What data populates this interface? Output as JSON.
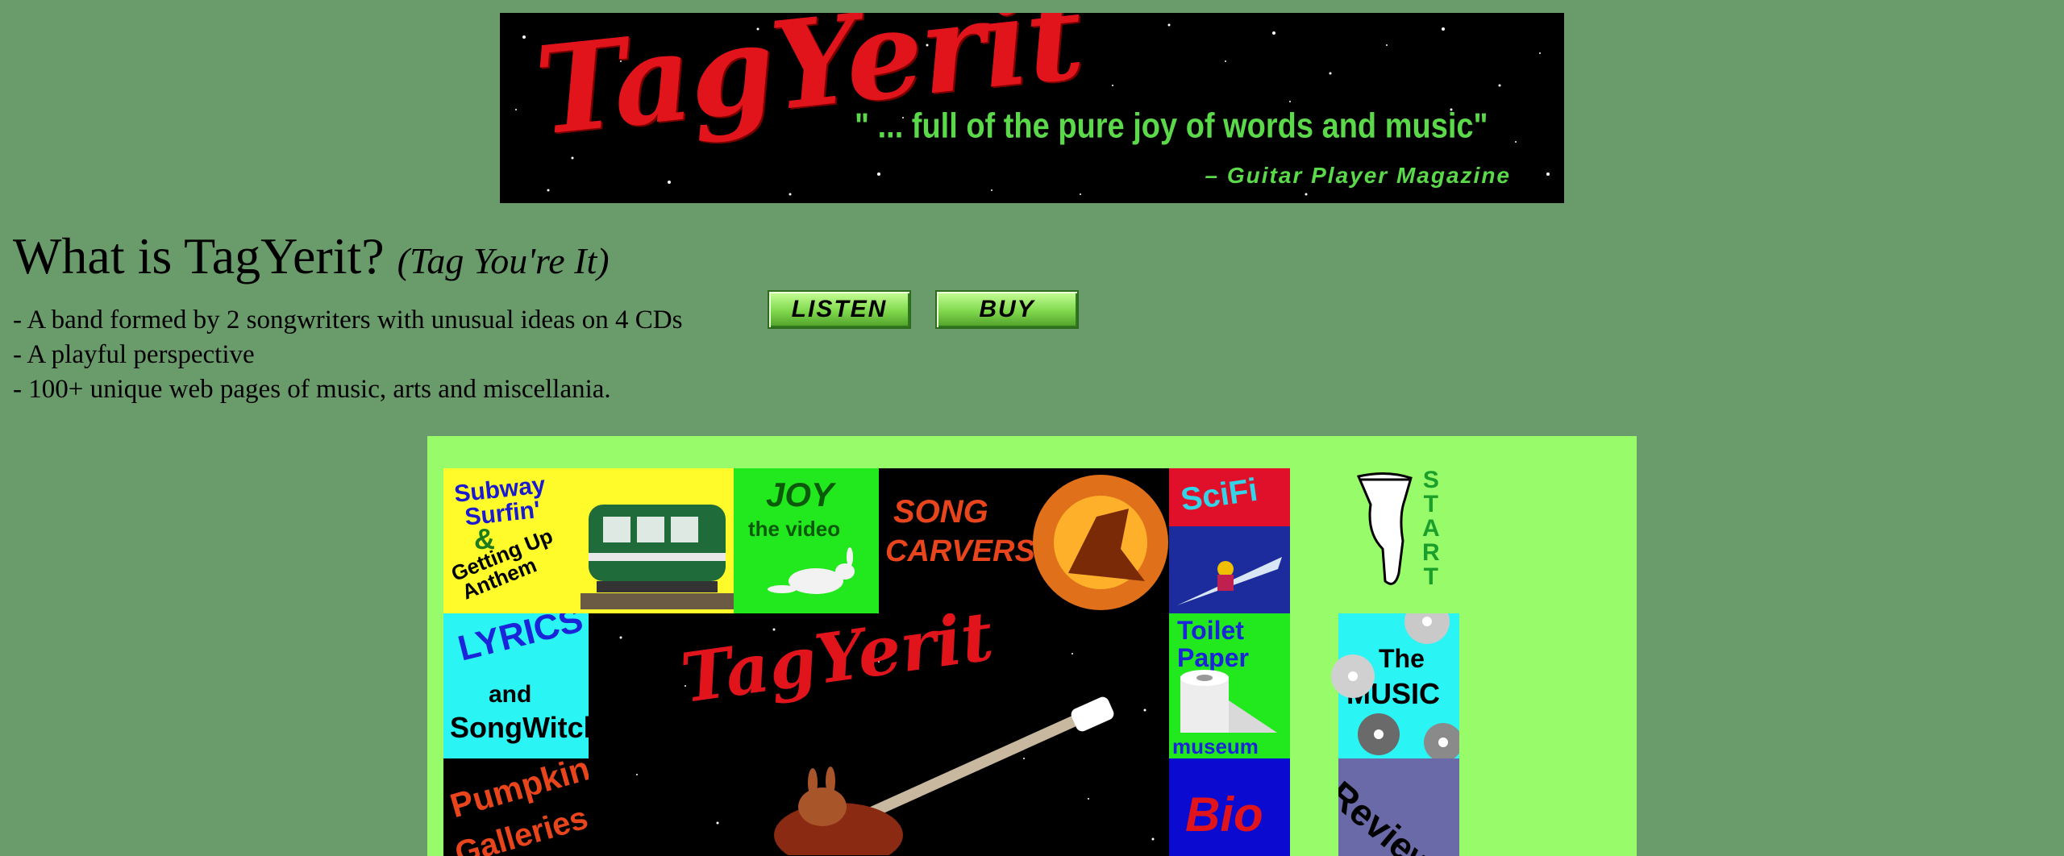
{
  "banner": {
    "logo": "TagYerit",
    "quote": "\" ... full of the pure joy of words and music\"",
    "source": "– Guitar Player Magazine"
  },
  "heading": {
    "title": "What is TagYerit?",
    "subtitle": "(Tag You're It)"
  },
  "bullets": [
    "- A band formed by 2 songwriters with unusual ideas on 4 CDs",
    "- A playful perspective",
    "- 100+ unique web pages of music, arts and miscellania."
  ],
  "buttons": {
    "listen": "LISTEN",
    "buy": "BUY"
  },
  "tiles": {
    "subway": [
      "Subway",
      "Surfin'",
      "&",
      "Getting Up",
      "Anthem"
    ],
    "joy": [
      "JOY",
      "the video"
    ],
    "song_carvers": [
      "SONG",
      "CARVERS"
    ],
    "scifi": "SciFi",
    "start": [
      "S",
      "T",
      "A",
      "R",
      "T"
    ],
    "lyrics": [
      "LYRICS",
      "and",
      "SongWitch"
    ],
    "center_logo": "TagYerit",
    "toilet_paper": [
      "Toilet",
      "Paper",
      "museum"
    ],
    "the_music": [
      "The",
      "MUSIC"
    ],
    "pumpkin": [
      "Pumpkin",
      "Galleries"
    ],
    "bio": "Bio",
    "reviews": "Reviews"
  },
  "colors": {
    "page_bg": "#6a9b6b",
    "panel_bg": "#97fb6a",
    "logo_red": "#e0141a",
    "quote_green": "#5bd94a"
  }
}
